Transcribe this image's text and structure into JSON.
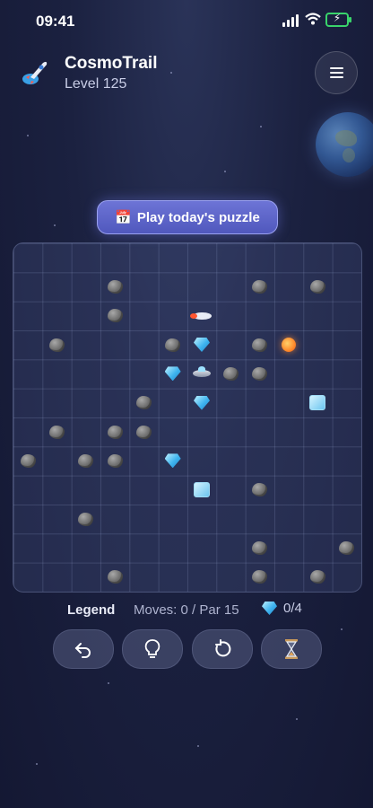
{
  "status_bar": {
    "time": "09:41"
  },
  "header": {
    "app_name": "CosmoTrail",
    "level": "Level 125",
    "menu_icon": "hamburger-menu-icon"
  },
  "daily_button": {
    "icon": "calendar-icon",
    "label": "Play today's puzzle"
  },
  "board": {
    "columns": 12,
    "rows": 12,
    "pieces": [
      {
        "type": "asteroid",
        "row": 1,
        "col": 3
      },
      {
        "type": "asteroid",
        "row": 1,
        "col": 8
      },
      {
        "type": "asteroid",
        "row": 1,
        "col": 10
      },
      {
        "type": "asteroid",
        "row": 2,
        "col": 3
      },
      {
        "type": "rocket",
        "row": 2,
        "col": 6
      },
      {
        "type": "asteroid",
        "row": 3,
        "col": 1
      },
      {
        "type": "asteroid",
        "row": 3,
        "col": 5
      },
      {
        "type": "gem",
        "row": 3,
        "col": 6
      },
      {
        "type": "asteroid",
        "row": 3,
        "col": 8
      },
      {
        "type": "comet",
        "row": 3,
        "col": 9
      },
      {
        "type": "gem",
        "row": 4,
        "col": 5
      },
      {
        "type": "ufo",
        "row": 4,
        "col": 6
      },
      {
        "type": "asteroid",
        "row": 4,
        "col": 7
      },
      {
        "type": "asteroid",
        "row": 4,
        "col": 8
      },
      {
        "type": "asteroid",
        "row": 5,
        "col": 4
      },
      {
        "type": "gem",
        "row": 5,
        "col": 6
      },
      {
        "type": "ice",
        "row": 5,
        "col": 10
      },
      {
        "type": "asteroid",
        "row": 6,
        "col": 1
      },
      {
        "type": "asteroid",
        "row": 6,
        "col": 3
      },
      {
        "type": "asteroid",
        "row": 6,
        "col": 4
      },
      {
        "type": "asteroid",
        "row": 7,
        "col": 0
      },
      {
        "type": "asteroid",
        "row": 7,
        "col": 2
      },
      {
        "type": "asteroid",
        "row": 7,
        "col": 3
      },
      {
        "type": "gem",
        "row": 7,
        "col": 5
      },
      {
        "type": "ice",
        "row": 8,
        "col": 6
      },
      {
        "type": "asteroid",
        "row": 8,
        "col": 8
      },
      {
        "type": "asteroid",
        "row": 9,
        "col": 2
      },
      {
        "type": "asteroid",
        "row": 10,
        "col": 8
      },
      {
        "type": "asteroid",
        "row": 10,
        "col": 11
      },
      {
        "type": "asteroid",
        "row": 11,
        "col": 3
      },
      {
        "type": "asteroid",
        "row": 11,
        "col": 8
      },
      {
        "type": "asteroid",
        "row": 11,
        "col": 10
      }
    ]
  },
  "footer": {
    "legend": "Legend",
    "moves": "Moves: 0 / Par 15",
    "gems": "0/4"
  },
  "controls": [
    {
      "name": "undo-button",
      "icon": "undo-icon"
    },
    {
      "name": "hint-button",
      "icon": "lightbulb-icon"
    },
    {
      "name": "restart-button",
      "icon": "restart-icon"
    },
    {
      "name": "timer-button",
      "icon": "hourglass-icon"
    }
  ],
  "colors": {
    "accent": "#5a62c8",
    "battery": "#39d36b",
    "background": "#1b2140"
  }
}
